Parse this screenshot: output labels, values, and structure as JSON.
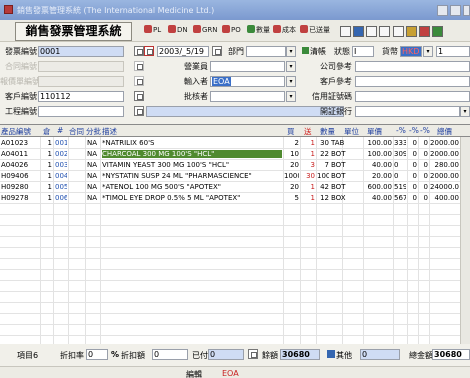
{
  "window": {
    "title": "銷售發票管理系統 (The International Medicine Ltd.)"
  },
  "toolbar": {
    "app_title": "銷售發票管理系統",
    "pl_label": "PL",
    "dn_label": "DN",
    "grn_label": "GRN",
    "po_label": "PO",
    "qty_label": "數量",
    "cost_label": "成本",
    "sent_label": "已送量"
  },
  "form": {
    "invoice_no_label": "發票編號",
    "invoice_no": "0001",
    "date": "2003/_5/19",
    "dept_label": "部門",
    "clear_label": "清帳",
    "status_label": "狀態",
    "status_value": "I",
    "currency_label": "貨幣",
    "currency_value": "HKD",
    "rate_value": "1",
    "contract_no_label": "合同編號",
    "sales_label": "營業員",
    "company_ref_label": "公司參考",
    "quote_no_label": "報價單編號",
    "entered_by_label": "輸入者",
    "entered_by_value": "EOA",
    "customer_ref_label": "客戶參考",
    "customer_no_label": "客戶編號",
    "customer_no": "110112",
    "approver_label": "批核者",
    "lc_no_label": "信用証號碼",
    "project_no_label": "工程編號",
    "issuing_bank_label": "開証銀行"
  },
  "grid": {
    "headers": {
      "product_code": "產品編號",
      "warehouse": "倉",
      "row_no": "#",
      "contract": "合同",
      "batch": "分批",
      "description": "描述",
      "buy": "買",
      "send": "送",
      "quantity": "數量",
      "unit": "單位",
      "unit_price": "單價",
      "pct1": "-%",
      "pct2": "-%",
      "pct3": "-%",
      "total": "總價"
    },
    "rows": [
      {
        "code": "A01023",
        "wh": "1",
        "no": "001",
        "batch": "NA",
        "desc": "*NATRILIX 60'S",
        "buy": "2",
        "send": "1",
        "qty": "30",
        "unit": "TAB",
        "price": "100.00",
        "p1": "333",
        "p2": "0",
        "p3": "0",
        "total": "2000.00"
      },
      {
        "code": "A04011",
        "wh": "1",
        "no": "002",
        "batch": "NA",
        "desc": "CHARCOAL 300 MG 100'S \"HCL\"",
        "buy": "10",
        "send": "1",
        "qty": "22",
        "unit": "BOT",
        "price": "100.00",
        "p1": "309",
        "p2": "0",
        "p3": "0",
        "total": "2000.00"
      },
      {
        "code": "A04026",
        "wh": "1",
        "no": "003",
        "batch": "NA",
        "desc": "VITAMIN YEAST 300 MG 100'S \"HCL\"",
        "buy": "20",
        "send": "3",
        "qty": "7",
        "unit": "BOT",
        "price": "40.00",
        "p1": "0",
        "p2": "0",
        "p3": "0",
        "total": "280.00"
      },
      {
        "code": "H09406",
        "wh": "1",
        "no": "004",
        "batch": "NA",
        "desc": "*NYSTATIN SUSP 24 ML \"PHARMASCIENCE\"",
        "buy": "1000",
        "send": "30",
        "qty": "100",
        "unit": "BOT",
        "price": "20.00",
        "p1": "0",
        "p2": "0",
        "p3": "0",
        "total": "2000.00"
      },
      {
        "code": "H09280",
        "wh": "1",
        "no": "005",
        "batch": "NA",
        "desc": "*ATENOL 100 MG 500'S \"APOTEX\"",
        "buy": "20",
        "send": "1",
        "qty": "42",
        "unit": "BOT",
        "price": "600.00",
        "p1": "519",
        "p2": "0",
        "p3": "0",
        "total": "24000.00"
      },
      {
        "code": "H09278",
        "wh": "1",
        "no": "006",
        "batch": "NA",
        "desc": "*TIMOL EYE DROP 0.5% 5 ML \"APOTEX\"",
        "buy": "5",
        "send": "1",
        "qty": "12",
        "unit": "BOX",
        "price": "40.00",
        "p1": "567",
        "p2": "0",
        "p3": "0",
        "total": "400.00"
      }
    ]
  },
  "footer": {
    "items_label": "項目6",
    "discount_rate_label": "折扣率",
    "discount_rate_value": "0",
    "pct_sign": "%",
    "discount_amount_label": "折扣額",
    "discount_amount_value": "0",
    "paid_label": "已付",
    "paid_value": "0",
    "net_label": "餘額",
    "net_value": "30680",
    "other_label": "其他",
    "other_value": "0",
    "grand_total_label": "總金額",
    "grand_total_value": "30680",
    "editor_label": "編輯",
    "editor_value": "EOA"
  }
}
